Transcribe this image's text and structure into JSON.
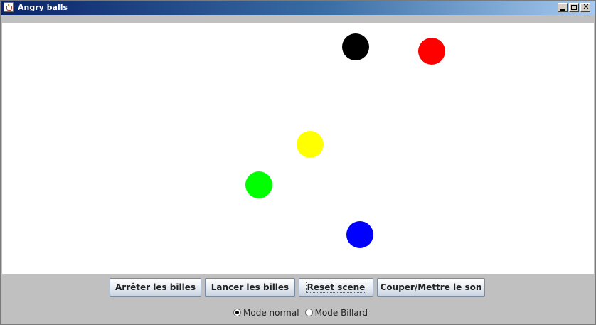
{
  "window": {
    "title": "Angry balls",
    "icon": "java-cup-icon"
  },
  "canvas": {
    "balls": [
      {
        "name": "ball-black",
        "color": "#000000"
      },
      {
        "name": "ball-red",
        "color": "#ff0000"
      },
      {
        "name": "ball-yellow",
        "color": "#ffff00"
      },
      {
        "name": "ball-green",
        "color": "#00ff00"
      },
      {
        "name": "ball-blue",
        "color": "#0000ff"
      }
    ]
  },
  "controls": {
    "stop_label": "Arrêter les billes",
    "start_label": "Lancer les billes",
    "reset_label": "Reset scene",
    "sound_label": "Couper/Mettre le son",
    "modes": [
      {
        "label": "Mode normal",
        "selected": true
      },
      {
        "label": "Mode Billard",
        "selected": false
      }
    ]
  }
}
